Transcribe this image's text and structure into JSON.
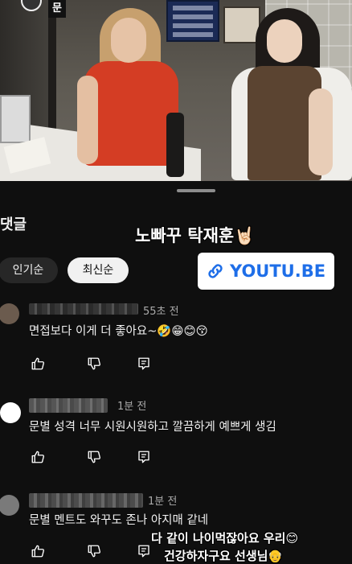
{
  "video": {
    "channel_badge": "문"
  },
  "comments_sheet": {
    "title": "댓글",
    "sort_chips": [
      {
        "label": "인기순",
        "selected": false
      },
      {
        "label": "최신순",
        "selected": true
      }
    ]
  },
  "overlays": {
    "caption": "노빠꾸 탁재훈🤘🏻",
    "link_badge": "YOUTU.BE",
    "bottom_line_1": "다 같이 나이먹잖아요 우리😊",
    "bottom_line_2": "건강하자구요 선생님👴"
  },
  "comments": [
    {
      "author": "@user-ri5r...",
      "time": "55초 전",
      "text": "면접보다 이게 더 좋아요~🤣😁😊😚"
    },
    {
      "author": "",
      "time": "1분 전",
      "text": "문별 성격 너무 시원시원하고  깔끔하게 예쁘게 생김"
    },
    {
      "author": "",
      "time": "1분 전",
      "text": "문별 멘트도 와꾸도 존나 아지매 같네"
    }
  ],
  "icons": {
    "like": "thumbs-up-icon",
    "dislike": "thumbs-down-icon",
    "reply": "reply-icon",
    "link": "link-icon"
  },
  "colors": {
    "background": "#0f0f0f",
    "chip_selected_bg": "#f1f1f1",
    "chip_bg": "#272727",
    "link_blue": "#1e6ee8",
    "secondary_text": "#aaaaaa"
  }
}
